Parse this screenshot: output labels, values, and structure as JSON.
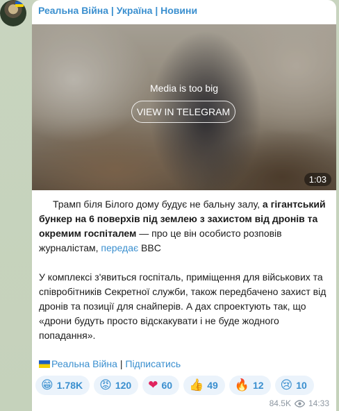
{
  "channel": {
    "name": "Реальна Війна | Україна | Новини"
  },
  "media": {
    "message": "Media is too big",
    "button_label": "VIEW IN TELEGRAM",
    "duration": "1:03"
  },
  "post": {
    "p1_plain_1": "Трамп біля Білого дому будує не бальну залу, ",
    "p1_bold": "а гігантський бункер на 6 поверхів під землею з захистом від дронів та окремим госпіталем",
    "p1_plain_2": " — про це він особисто розповів журналістам, ",
    "p1_link": "передає",
    "p1_plain_3": " BBC",
    "p2": "У комплексі з'явиться госпіталь, приміщення для військових та співробітників Секретної служби, також передбачено захист від дронів та позиції для снайперів. А дах спроектують так, що «дрони будуть просто відскакувати і не буде жодного попадання»."
  },
  "signature": {
    "channel_link": "Реальна Війна",
    "separator": " | ",
    "subscribe_link": "Підписатись"
  },
  "reactions": [
    {
      "icon": "grinning-face-icon",
      "emoji": "😁",
      "count": "1.78K"
    },
    {
      "icon": "angry-face-icon",
      "emoji": "😡",
      "count": "120"
    },
    {
      "icon": "red-heart-icon",
      "emoji": "❤",
      "count": "60"
    },
    {
      "icon": "thumbs-up-icon",
      "emoji": "👍",
      "count": "49"
    },
    {
      "icon": "fire-icon",
      "emoji": "🔥",
      "count": "12"
    },
    {
      "icon": "sad-face-icon",
      "emoji": "😢",
      "count": "10"
    }
  ],
  "footer": {
    "views": "84.5K",
    "time": "14:33"
  },
  "colors": {
    "accent": "#3a8fcf",
    "reaction_bg": "#ebf3fb",
    "wallpaper": "#c8d4bf"
  }
}
